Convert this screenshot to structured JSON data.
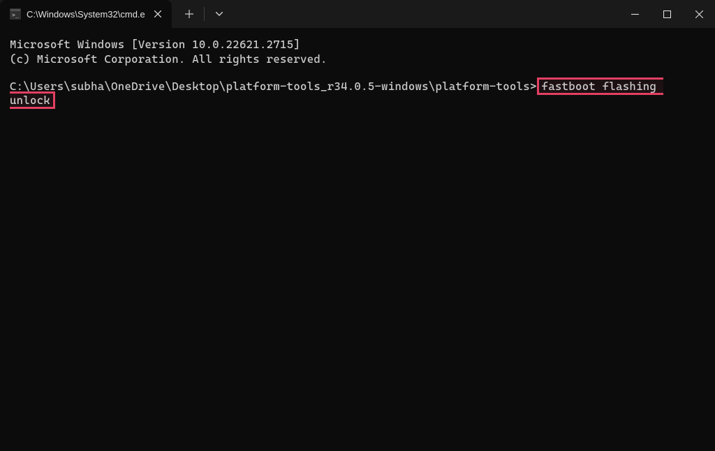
{
  "titlebar": {
    "tab_title": "C:\\Windows\\System32\\cmd.e",
    "tab_icon": "cmd-icon"
  },
  "terminal": {
    "line1": "Microsoft Windows [Version 10.0.22621.2715]",
    "line2": "(c) Microsoft Corporation. All rights reserved.",
    "prompt": "C:\\Users\\subha\\OneDrive\\Desktop\\platform-tools_r34.0.5-windows\\platform-tools>",
    "command": "fastboot flashing unlock"
  }
}
